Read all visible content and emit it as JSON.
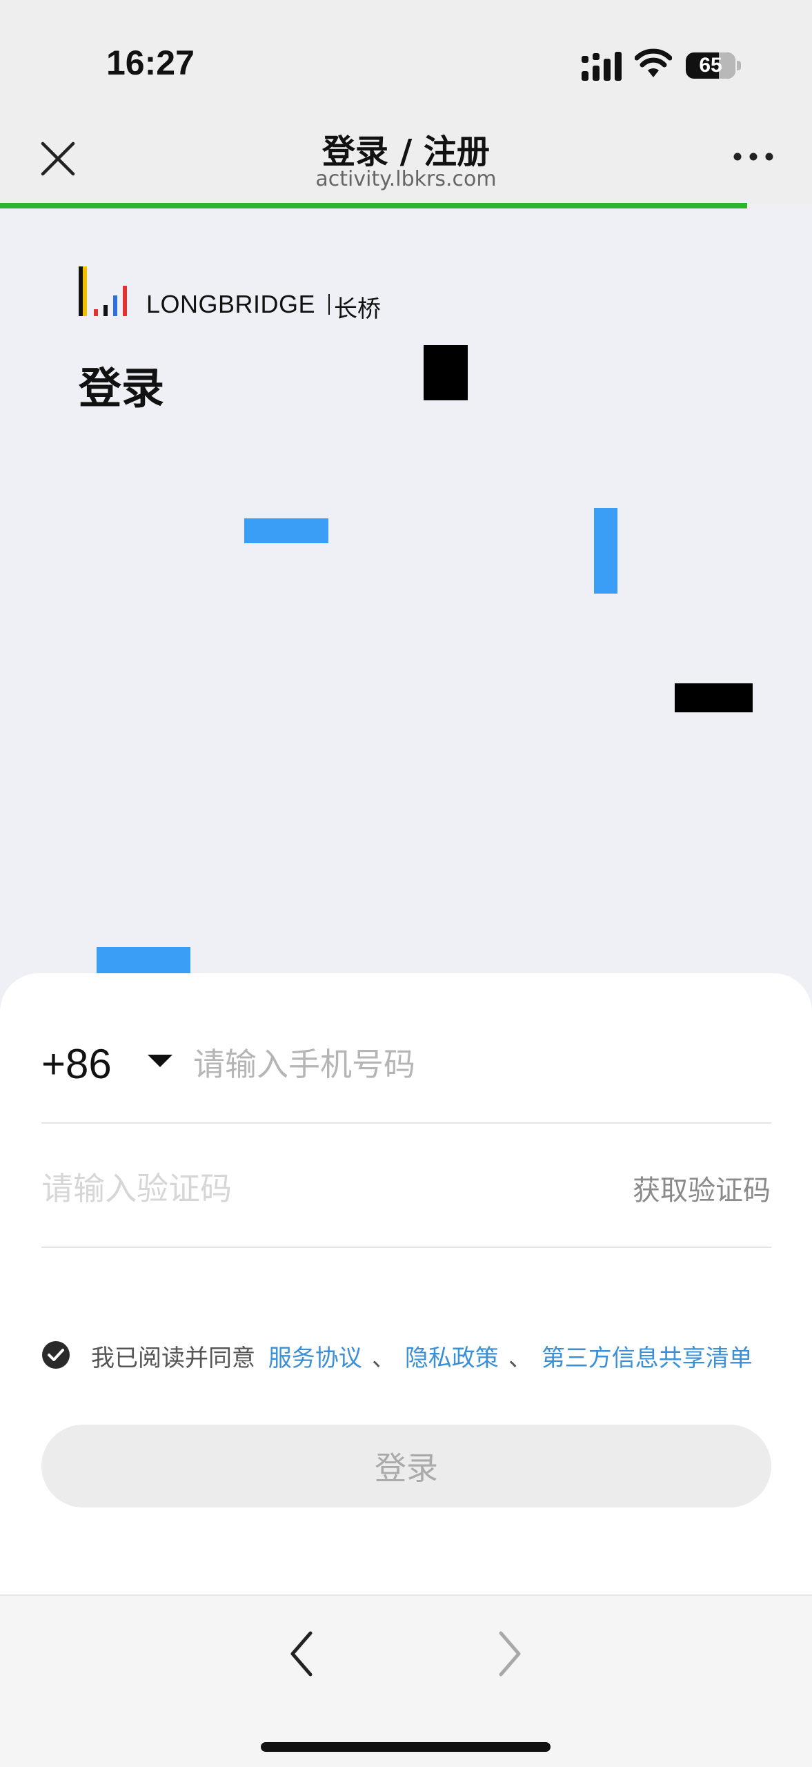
{
  "status_bar": {
    "time": "16:27",
    "battery": "65"
  },
  "nav": {
    "title": "登录 / 注册",
    "subtitle": "activity.lbkrs.com",
    "load_progress_percent": 92
  },
  "brand": {
    "logo_text": "LONGBRIDGE",
    "logo_cn": "长桥"
  },
  "page": {
    "title": "登录"
  },
  "form": {
    "country_code": "+86",
    "phone_placeholder": "请输入手机号码",
    "code_placeholder": "请输入验证码",
    "get_code_label": "获取验证码",
    "agree_prefix": "我已阅读并同意",
    "terms_label": "服务协议",
    "privacy_label": "隐私政策",
    "third_party_label": "第三方信息共享清单",
    "separator": "、",
    "login_label": "登录"
  },
  "colors": {
    "accent_green": "#2bb52f",
    "link_blue": "#3a8fd6",
    "deco_blue": "#3a9ef7",
    "deco_black": "#000000"
  }
}
